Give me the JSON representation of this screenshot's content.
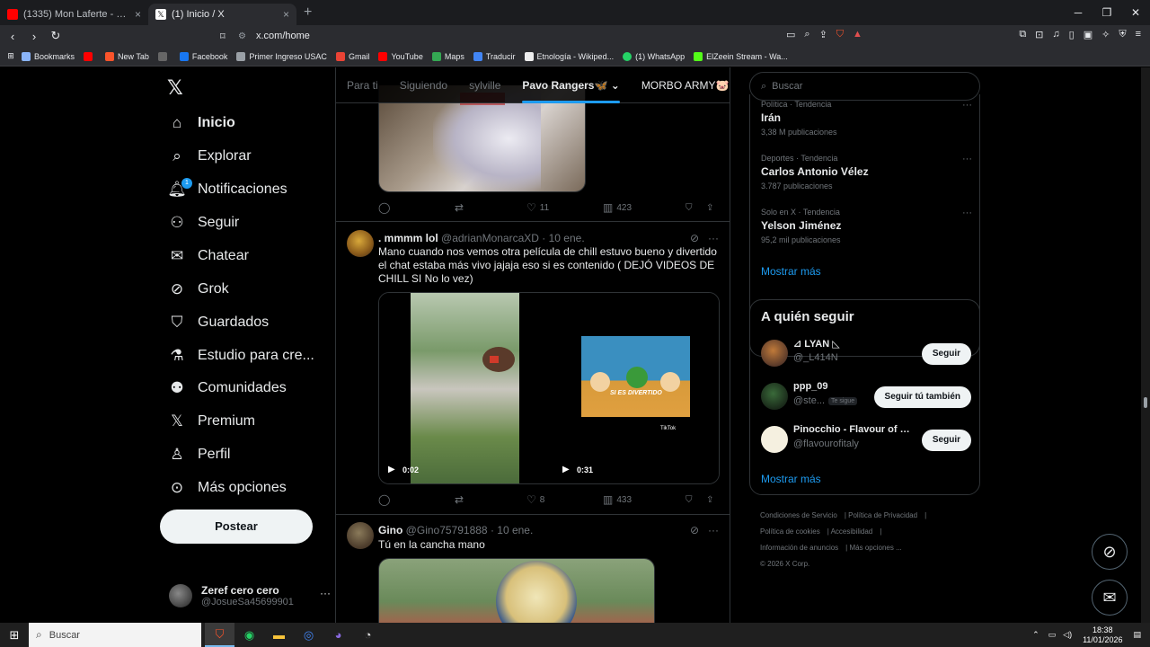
{
  "browser": {
    "tabs": [
      {
        "title": "(1335) Mon Laferte - La Nave del Olvido",
        "active": false
      },
      {
        "title": "(1) Inicio / X",
        "active": true
      }
    ],
    "url": "x.com/home",
    "bookmarks": [
      "Bookmarks",
      "New Tab",
      "Facebook",
      "Primer Ingreso USAC",
      "Gmail",
      "YouTube",
      "Maps",
      "Traducir",
      "Etnología - Wikiped...",
      "(1) WhatsApp",
      "ElZeein Stream - Wa..."
    ]
  },
  "nav": {
    "items": [
      {
        "label": "Inicio",
        "icon": "home-icon"
      },
      {
        "label": "Explorar",
        "icon": "search-icon"
      },
      {
        "label": "Notificaciones",
        "icon": "bell-icon",
        "badge": "1"
      },
      {
        "label": "Seguir",
        "icon": "add-person-icon"
      },
      {
        "label": "Chatear",
        "icon": "mail-icon"
      },
      {
        "label": "Grok",
        "icon": "grok-icon"
      },
      {
        "label": "Guardados",
        "icon": "bookmark-icon"
      },
      {
        "label": "Estudio para cre...",
        "icon": "flask-icon"
      },
      {
        "label": "Comunidades",
        "icon": "people-icon"
      },
      {
        "label": "Premium",
        "icon": "x-icon"
      },
      {
        "label": "Perfil",
        "icon": "person-icon"
      },
      {
        "label": "Más opciones",
        "icon": "more-circle-icon"
      }
    ],
    "post_label": "Postear",
    "account": {
      "name": "Zeref cero cero",
      "handle": "@JosueSa45699901"
    }
  },
  "timeline": {
    "tabs": [
      "Para ti",
      "Siguiendo",
      "sylville",
      "Pavo Rangers🦋",
      "MORBO ARMY🐷"
    ],
    "active_tab": "Pavo Rangers🦋",
    "first_tweet_stats": {
      "likes": "11",
      "views": "423"
    },
    "tweets": [
      {
        "name": ". mmmm lol",
        "handle": "@adrianMonarcaXD",
        "date": "· 10 ene.",
        "text": "Mano cuando nos vemos otra película de chill estuvo bueno y divertido el chat estaba más vivo jajaja eso si es contenido ( DEJÓ VIDEOS DE CHILL SI No lo vez)",
        "videos": [
          {
            "duration": "0:02"
          },
          {
            "duration": "0:31",
            "caption": "SI ES DIVERTIDO",
            "watermark": "TikTok"
          }
        ],
        "likes": "8",
        "views": "433"
      },
      {
        "name": "Gino",
        "handle": "@Gino75791888",
        "date": "· 10 ene.",
        "text": "Tú en la cancha mano"
      }
    ]
  },
  "sidebar": {
    "search_placeholder": "Buscar",
    "trends": [
      {
        "category": "Política · Tendencia",
        "name": "Irán",
        "count": "3,38 M publicaciones"
      },
      {
        "category": "Deportes · Tendencia",
        "name": "Carlos Antonio Vélez",
        "count": "3.787 publicaciones"
      },
      {
        "category": "Solo en X · Tendencia",
        "name": "Yelson Jiménez",
        "count": "95,2 mil publicaciones"
      }
    ],
    "show_more": "Mostrar más",
    "who_to_follow_title": "A quién seguir",
    "who_to_follow": [
      {
        "name": "⊿ LYAN ◺",
        "handle": "@_L414N",
        "button": "Seguir"
      },
      {
        "name": "ppp_09",
        "handle": "@ste...",
        "follows_you": "Te sigue",
        "button": "Seguir tú también"
      },
      {
        "name": "Pinocchio - Flavour of I...",
        "handle": "@flavourofitaly",
        "button": "Seguir"
      }
    ],
    "footer": [
      "Condiciones de Servicio",
      "Política de Privacidad",
      "Política de cookies",
      "Accesibilidad",
      "Información de anuncios",
      "Más opciones ...",
      "© 2026 X Corp."
    ]
  },
  "taskbar": {
    "search_placeholder": "Buscar",
    "time": "18:38",
    "date": "11/01/2026"
  },
  "colors": {
    "accent": "#1d9bf0",
    "background": "#000000",
    "text": "#e7e9ea",
    "muted": "#71767b",
    "border": "#2f3336"
  }
}
